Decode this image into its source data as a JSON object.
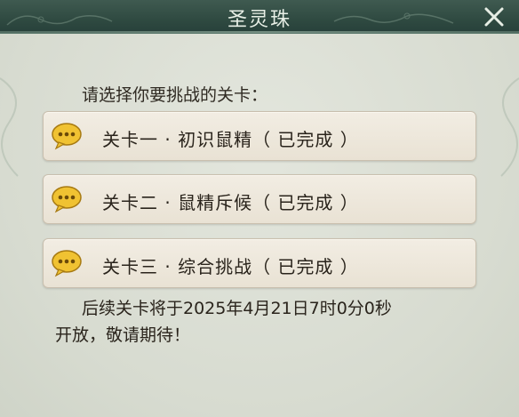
{
  "window": {
    "title": "圣灵珠"
  },
  "prompt": "请选择你要挑战的关卡：",
  "stages": [
    {
      "label": "关卡一 · 初识鼠精（ 已完成 ）"
    },
    {
      "label": "关卡二 · 鼠精斥候（ 已完成 ）"
    },
    {
      "label": "关卡三 · 综合挑战（ 已完成 ）"
    }
  ],
  "notice": {
    "line1": "后续关卡将于2025年4月21日7时0分0秒",
    "line2": "开放，敬请期待！"
  },
  "icons": {
    "close": "close-icon",
    "stage": "speech-bubble-icon"
  },
  "colors": {
    "titlebar": "#2f4a41",
    "panel": "#d9ddd3",
    "button": "#ede6d9",
    "bubble": "#f0c232"
  }
}
